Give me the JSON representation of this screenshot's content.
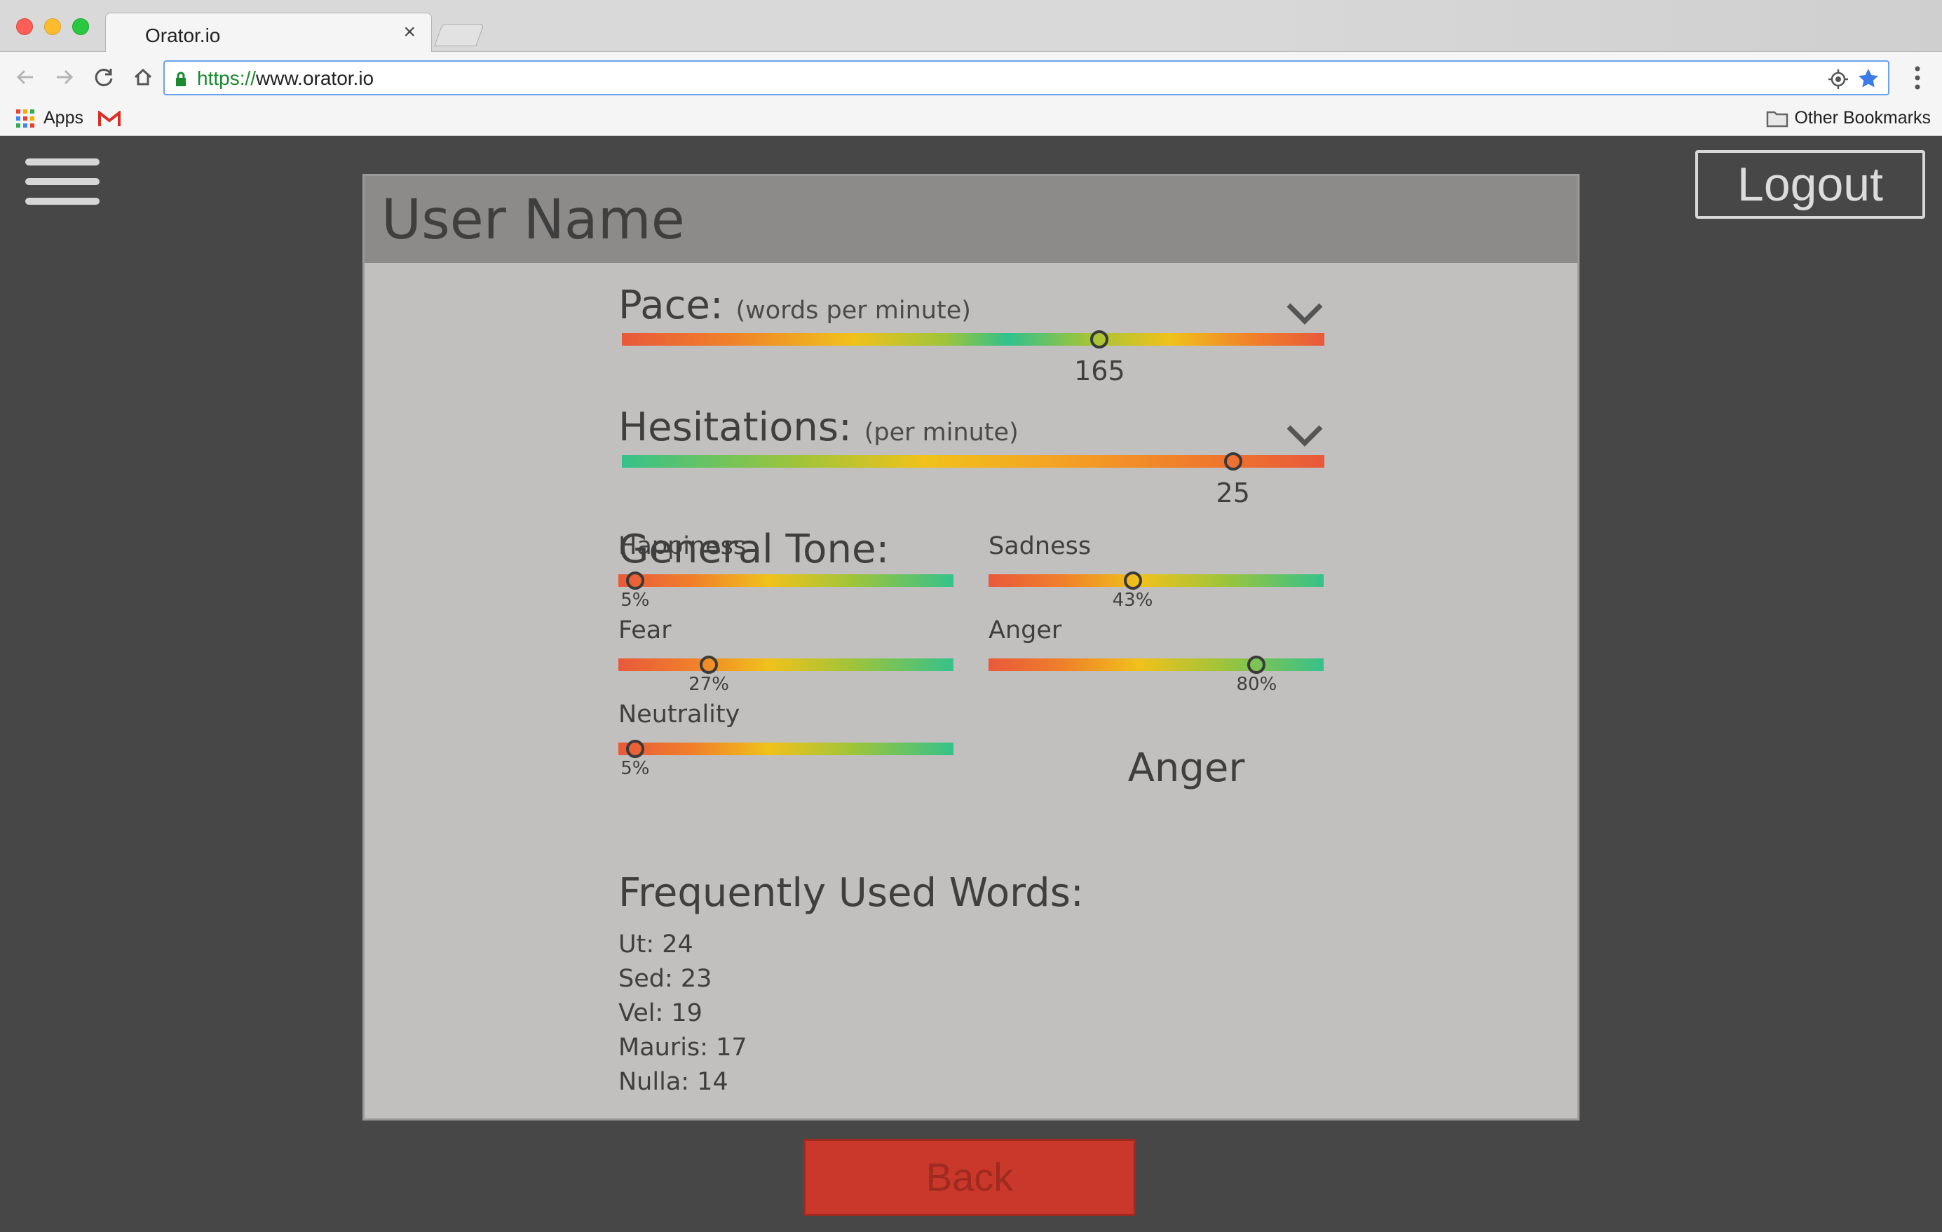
{
  "browser": {
    "tab_title": "Orator.io",
    "tab_close": "×",
    "url_scheme": "https://",
    "url_rest": "www.orator.io",
    "bookmarks": {
      "apps_label": "Apps",
      "other_label": "Other Bookmarks"
    },
    "icons": [
      "back-arrow-icon",
      "forward-arrow-icon",
      "reload-icon",
      "home-icon",
      "lock-icon",
      "location-target-icon",
      "star-icon",
      "kebab-menu-icon",
      "apps-grid-icon",
      "gmail-icon",
      "folder-icon"
    ]
  },
  "app": {
    "logout_label": "Logout",
    "user_name": "User Name",
    "pace": {
      "title": "Pace:",
      "subtitle": "(words per minute)",
      "value": 165,
      "value_label": "165",
      "position": 0.68
    },
    "hesitations": {
      "title": "Hesitations:",
      "subtitle": "(per minute)",
      "value": 25,
      "value_label": "25",
      "position": 0.87
    },
    "tone": {
      "title": "General Tone:",
      "emotions": [
        {
          "label": "Happiness",
          "value_label": "5%",
          "value": 0.05
        },
        {
          "label": "Sadness",
          "value_label": "43%",
          "value": 0.43
        },
        {
          "label": "Fear",
          "value_label": "27%",
          "value": 0.27
        },
        {
          "label": "Anger",
          "value_label": "80%",
          "value": 0.8
        },
        {
          "label": "Neutrality",
          "value_label": "5%",
          "value": 0.05
        }
      ],
      "dominant": "Anger"
    },
    "words": {
      "title": "Frequently Used Words:",
      "items": [
        "Ut: 24",
        "Sed: 23",
        "Vel: 19",
        "Mauris: 17",
        "Nulla: 14"
      ]
    },
    "back_label": "Back"
  },
  "colors": {
    "background": "#474747",
    "card": "#c1c0bf",
    "card_header": "#8c8b89",
    "back_button": "#c9382a",
    "gradient_red": "#e8593a",
    "gradient_yellow": "#f0c21b",
    "gradient_green": "#2fc28c"
  }
}
